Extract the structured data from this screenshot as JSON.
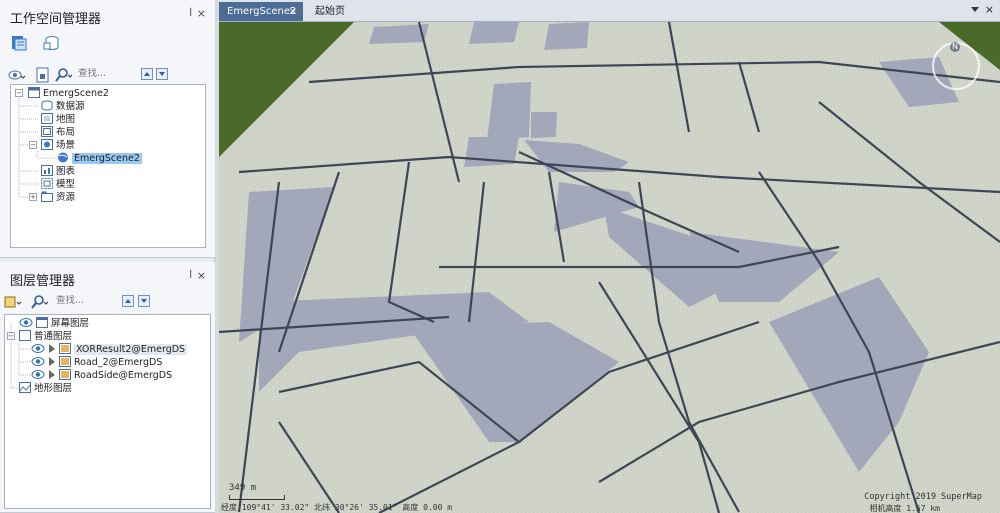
{
  "workspace_panel": {
    "title": "工作空间管理器",
    "pin": "ꟾ",
    "close": "×",
    "search_placeholder": "查找...",
    "tree": {
      "root": "EmergScene2",
      "datasource": "数据源",
      "map": "地图",
      "layout": "布局",
      "scene": "场景",
      "scene_child": "EmergScene2",
      "chart": "图表",
      "model": "模型",
      "resource": "资源"
    }
  },
  "layer_panel": {
    "title": "图层管理器",
    "pin": "ꟾ",
    "close": "×",
    "search_placeholder": "查找...",
    "tree": {
      "screen_layer": "屏幕图层",
      "normal_layer": "普通图层",
      "layer1": "XORResult2@EmergDS",
      "layer2": "Road_2@EmergDS",
      "layer3": "RoadSide@EmergDS",
      "terrain_layer": "地形图层"
    }
  },
  "tabs": {
    "active": "EmergScene2",
    "active_close": "×",
    "other": "起始页",
    "close": "×"
  },
  "scene": {
    "scale_label": "349 m",
    "status": "经度 109°41' 33.02\"  北纬 30°26' 35.01\"  高度 0.00 m",
    "copyright": "Copyright 2019 SuperMap",
    "camera_height": "相机高度 1.57 km",
    "compass": "N"
  },
  "colors": {
    "accent": "#4d6c96",
    "selected": "#99c9f2",
    "block_light": "#d0d4c8",
    "block_dark": "#a0a6ba",
    "grass": "#4a6a2a"
  }
}
